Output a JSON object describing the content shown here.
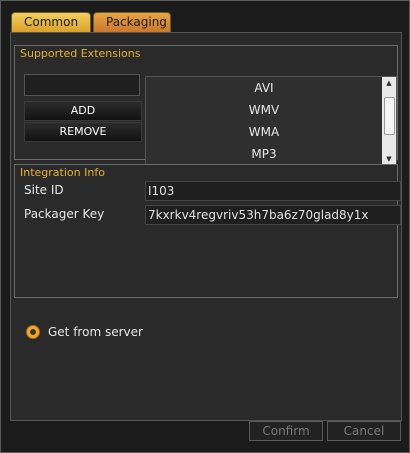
{
  "tabs": [
    {
      "label": "Common"
    },
    {
      "label": "Packaging"
    }
  ],
  "supported_extensions": {
    "title": "Supported Extensions",
    "input_value": "",
    "add_label": "ADD",
    "remove_label": "REMOVE",
    "items": [
      "AVI",
      "WMV",
      "WMA",
      "MP3"
    ]
  },
  "integration": {
    "title": "Integration Info",
    "site_id_label": "Site ID",
    "site_id_value": "I103",
    "packager_key_label": "Packager Key",
    "packager_key_value": "7kxrkv4regvriv53h7ba6z70glad8y1x"
  },
  "radio": {
    "label": "Get from server",
    "selected": true
  },
  "footer": {
    "confirm_label": "Confirm",
    "cancel_label": "Cancel"
  },
  "colors": {
    "accent": "#e7b12e"
  }
}
